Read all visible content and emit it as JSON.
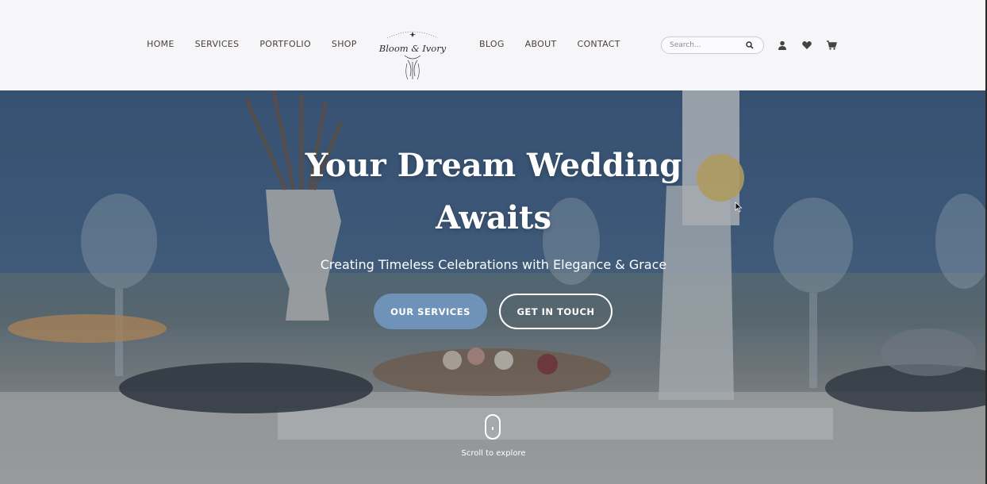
{
  "nav": {
    "left": [
      "HOME",
      "SERVICES",
      "PORTFOLIO",
      "SHOP"
    ],
    "right": [
      "BLOG",
      "ABOUT",
      "CONTACT"
    ]
  },
  "logo": {
    "text": "Bloom & Ivory"
  },
  "search": {
    "placeholder": "Search..."
  },
  "icons": {
    "search": "search-icon",
    "account": "user-icon",
    "wishlist": "heart-icon",
    "cart": "cart-icon"
  },
  "hero": {
    "title": "Your Dream Wedding Awaits",
    "subtitle": "Creating Timeless Celebrations with Elegance & Grace",
    "primary_button": "OUR SERVICES",
    "secondary_button": "GET IN TOUCH",
    "scroll_text": "Scroll to explore"
  },
  "colors": {
    "accent": "#6f93b8",
    "nav_text": "#4b3f3c",
    "header_bg": "#f6f6f9"
  }
}
